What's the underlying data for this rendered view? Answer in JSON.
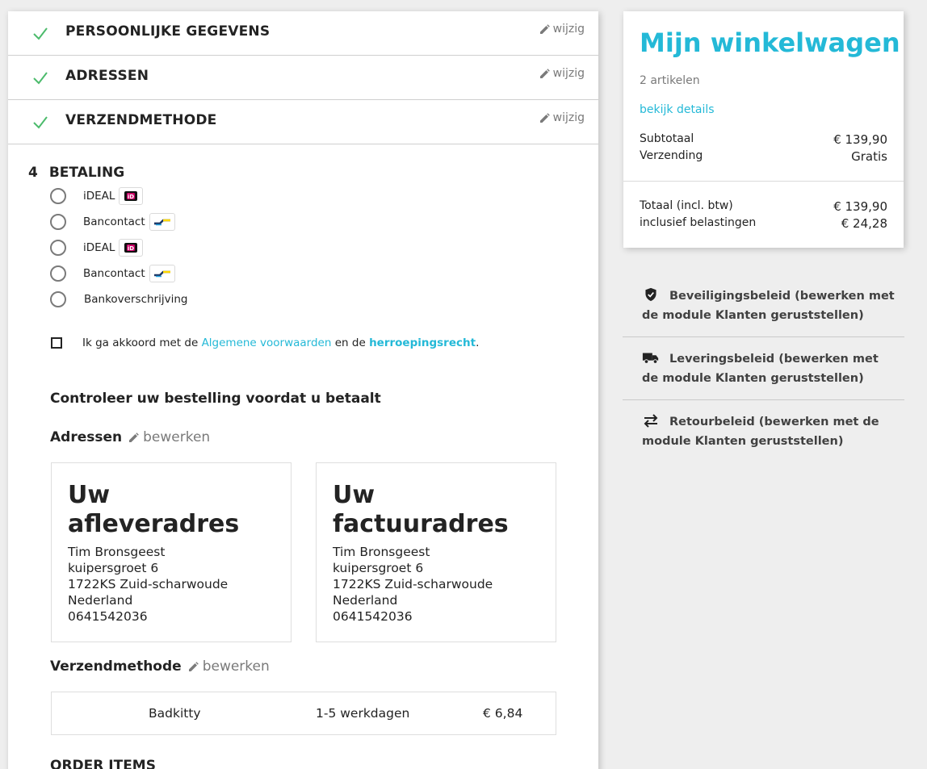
{
  "steps": [
    {
      "title": "PERSOONLIJKE GEGEVENS",
      "edit": "wijzig"
    },
    {
      "title": "ADRESSEN",
      "edit": "wijzig"
    },
    {
      "title": "VERZENDMETHODE",
      "edit": "wijzig"
    }
  ],
  "payment": {
    "number": "4",
    "title": "BETALING",
    "options": [
      {
        "label": "iDEAL",
        "icon": "ideal-logo"
      },
      {
        "label": "Bancontact",
        "icon": "bancontact-logo"
      },
      {
        "label": "iDEAL",
        "icon": "ideal-logo"
      },
      {
        "label": "Bancontact",
        "icon": "bancontact-logo"
      },
      {
        "label": "Bankoverschrijving",
        "icon": ""
      }
    ],
    "terms": {
      "prefix": "Ik ga akkoord met de ",
      "link1": "Algemene voorwaarden",
      "middle": " en de ",
      "link2": "herroepingsrecht",
      "suffix": "."
    }
  },
  "review": {
    "title": "Controleer uw bestelling voordat u betaalt",
    "addresses_heading": "Adressen",
    "edit_label": "bewerken",
    "delivery": {
      "heading": "Uw afleveradres",
      "lines": [
        "Tim Bronsgeest",
        "kuipersgroet 6",
        "1722KS Zuid-scharwoude",
        "Nederland",
        "0641542036"
      ]
    },
    "invoice": {
      "heading": "Uw factuuradres",
      "lines": [
        "Tim Bronsgeest",
        "kuipersgroet 6",
        "1722KS Zuid-scharwoude",
        "Nederland",
        "0641542036"
      ]
    },
    "shipping_heading": "Verzendmethode",
    "shipping": {
      "carrier": "Badkitty",
      "delay": "1-5 werkdagen",
      "price": "€ 6,84"
    },
    "order_items": "ORDER ITEMS"
  },
  "cart": {
    "title": "Mijn winkelwagen",
    "count": "2 artikelen",
    "details_link": "bekijk details",
    "subtotal_label": "Subtotaal",
    "subtotal_value": "€ 139,90",
    "shipping_label": "Verzending",
    "shipping_value": "Gratis",
    "total_label": "Totaal (incl. btw)",
    "total_value": "€ 139,90",
    "tax_label": "inclusief belastingen",
    "tax_value": "€ 24,28"
  },
  "policies": [
    {
      "icon": "shield-check-icon",
      "text": "Beveiligingsbeleid (bewerken met de module Klanten geruststellen)"
    },
    {
      "icon": "truck-icon",
      "text": "Leveringsbeleid (bewerken met de module Klanten geruststellen)"
    },
    {
      "icon": "swap-arrows-icon",
      "text": "Retourbeleid (bewerken met de module Klanten geruststellen)"
    }
  ],
  "colors": {
    "accent": "#24b9d7",
    "check": "#4cbb6c",
    "text": "#232323",
    "muted": "#7a7a7a",
    "background": "#eeeeee"
  }
}
